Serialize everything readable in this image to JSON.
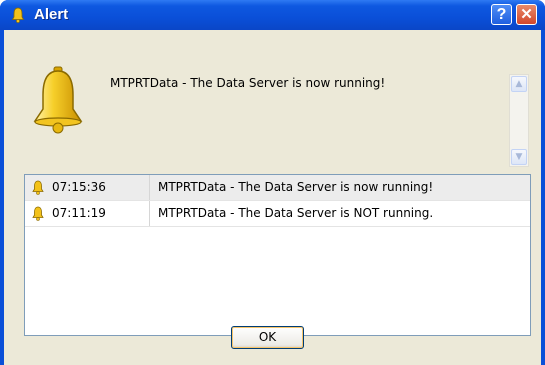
{
  "window": {
    "title": "Alert",
    "help_label": "?",
    "close_label": "✕",
    "titlebar_color": "#0a4fd8"
  },
  "alert": {
    "icon": "bell-icon",
    "message": "MTPRTData - The Data Server is now running!"
  },
  "log": {
    "rows": [
      {
        "icon": "bell-icon",
        "time": "07:15:36",
        "message": "MTPRTData - The Data Server is now running!",
        "selected": true
      },
      {
        "icon": "bell-icon",
        "time": "07:11:19",
        "message": "MTPRTData - The Data Server is NOT running.",
        "selected": false
      }
    ]
  },
  "buttons": {
    "ok_label": "OK"
  }
}
